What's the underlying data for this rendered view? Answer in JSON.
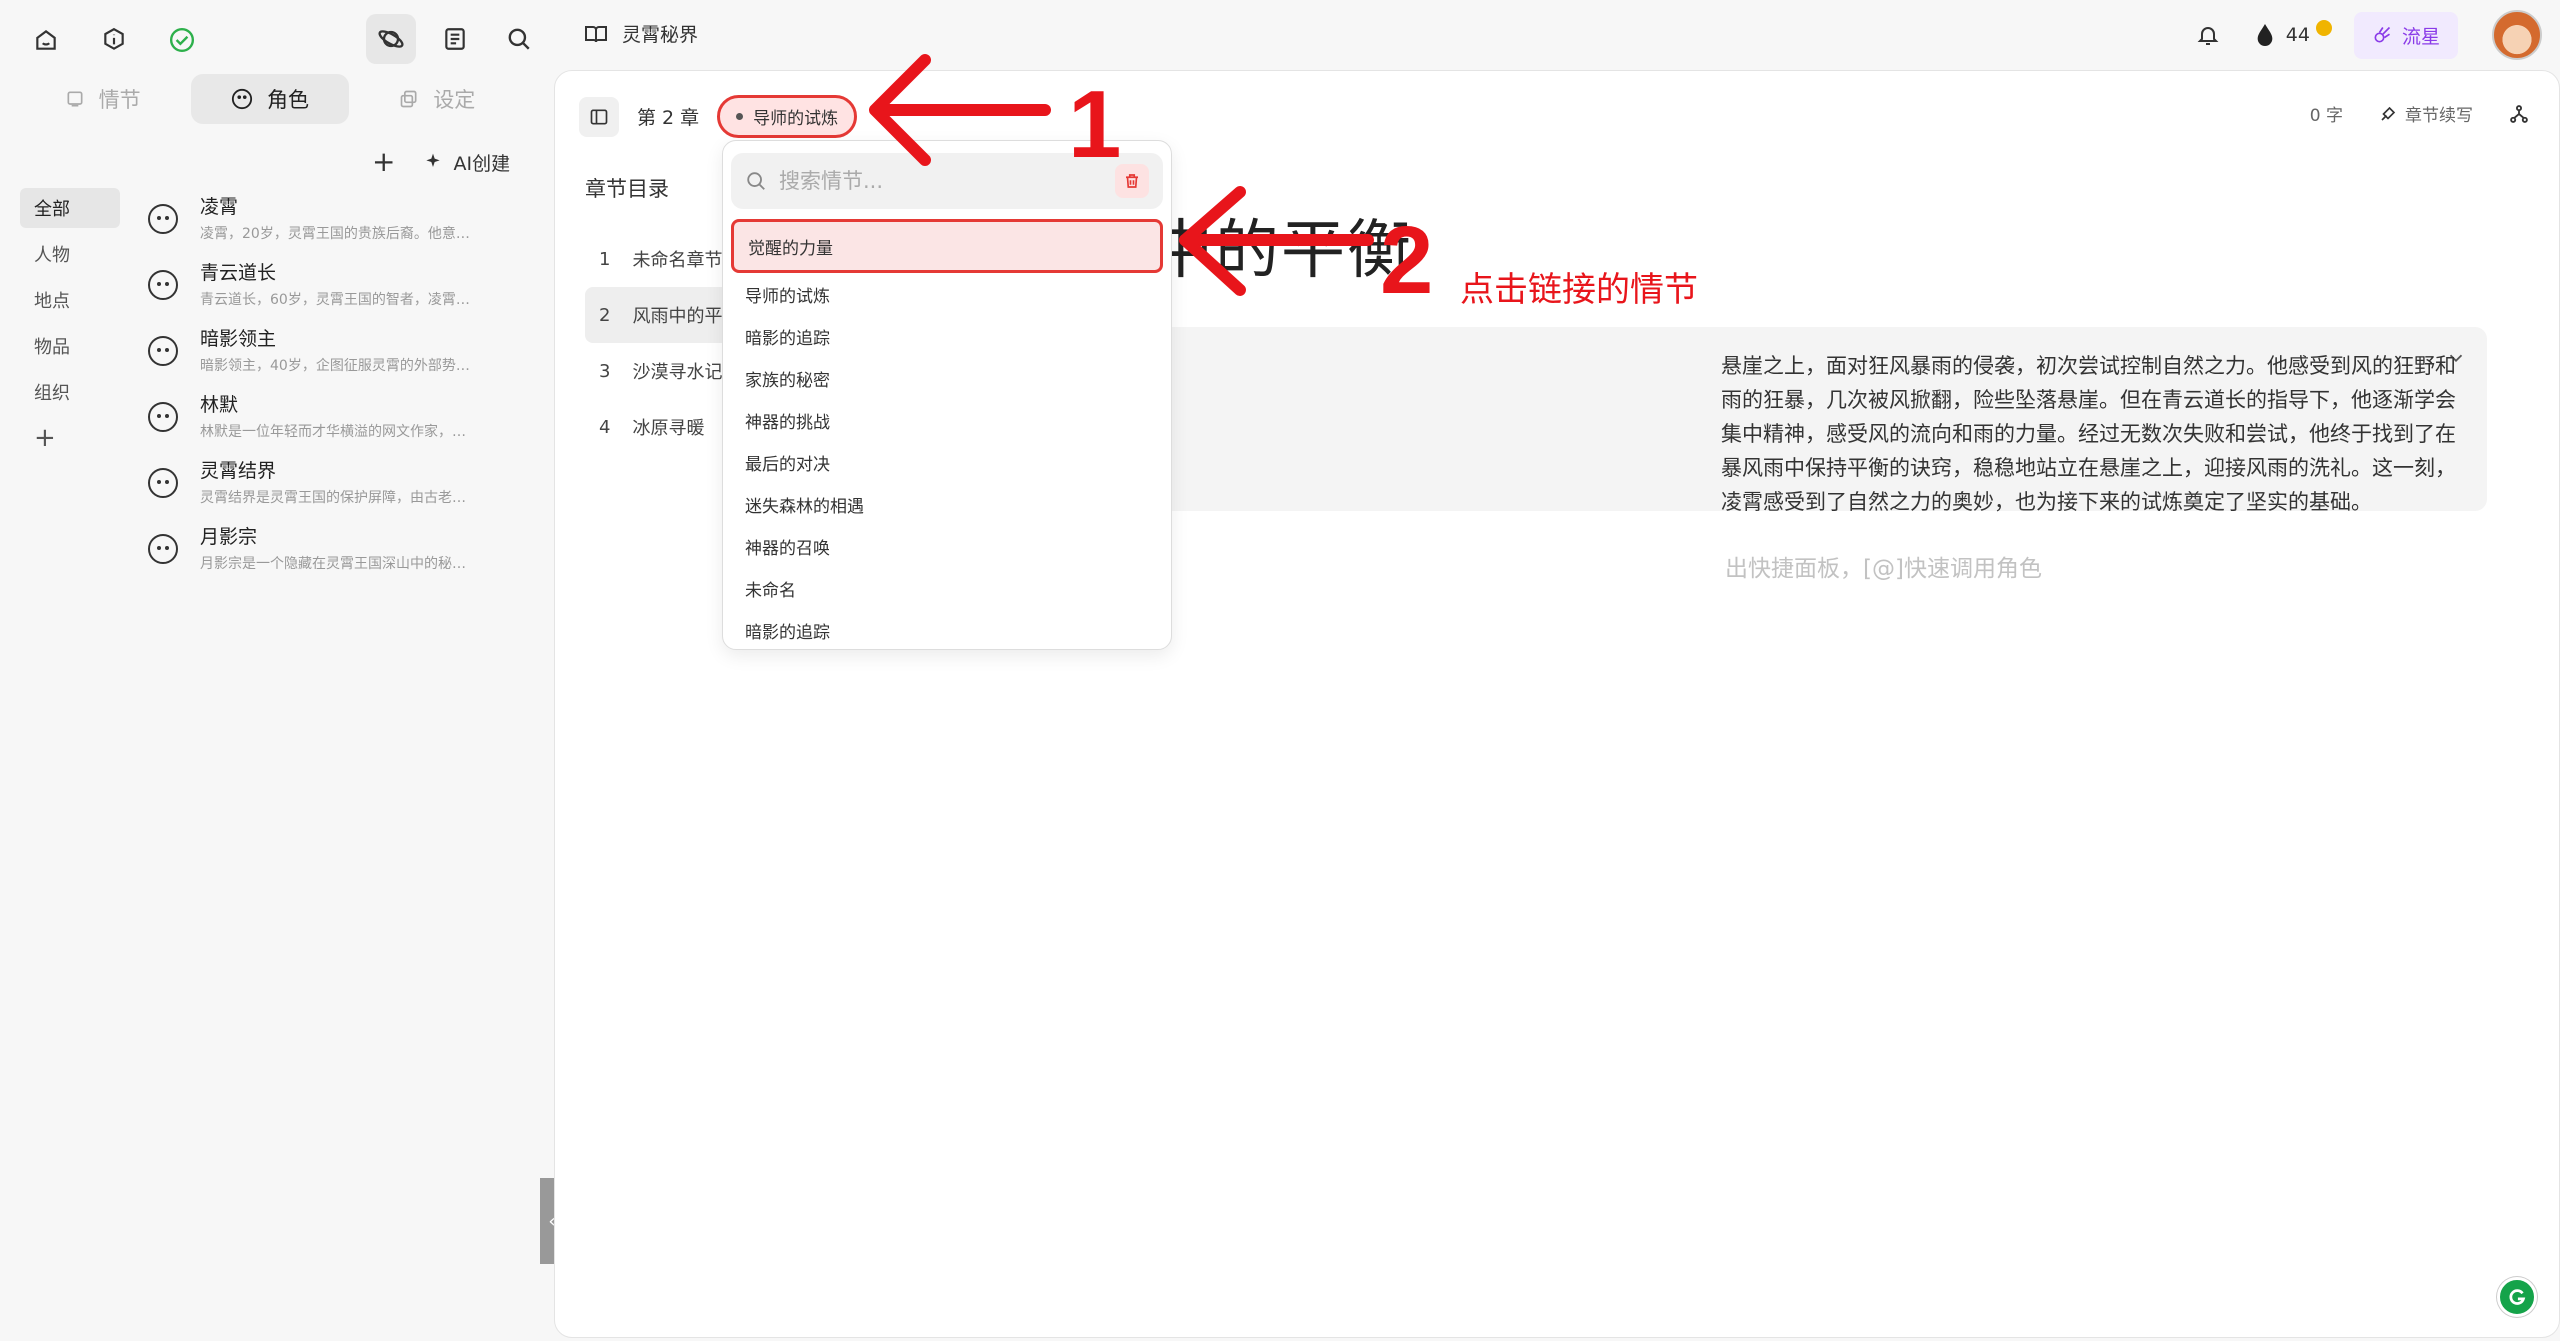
{
  "sidebar": {
    "tabs": [
      {
        "label": "情节",
        "active": false
      },
      {
        "label": "角色",
        "active": true
      },
      {
        "label": "设定",
        "active": false
      }
    ],
    "add_label": "+",
    "ai_create_label": "AI创建",
    "categories": [
      {
        "label": "全部",
        "active": true
      },
      {
        "label": "人物"
      },
      {
        "label": "地点"
      },
      {
        "label": "物品"
      },
      {
        "label": "组织"
      }
    ],
    "add_category": "+",
    "characters": [
      {
        "name": "凌霄",
        "desc": "凌霄，20岁，灵霄王国的贵族后裔。他意…"
      },
      {
        "name": "青云道长",
        "desc": "青云道长，60岁，灵霄王国的智者，凌霄…"
      },
      {
        "name": "暗影领主",
        "desc": "暗影领主，40岁，企图征服灵霄的外部势…"
      },
      {
        "name": "林默",
        "desc": "林默是一位年轻而才华横溢的网文作家，…"
      },
      {
        "name": "灵霄结界",
        "desc": "灵霄结界是灵霄王国的保护屏障，由古老…"
      },
      {
        "name": "月影宗",
        "desc": "月影宗是一个隐藏在灵霄王国深山中的秘…"
      }
    ]
  },
  "header": {
    "project": "灵霄秘界",
    "credits": "44",
    "plan": "流星"
  },
  "main": {
    "chapter_label": "第 2 章",
    "linked_plot": "导师的试炼",
    "word_count": "0 字",
    "continue_label": "章节续写",
    "toc_title": "章节目录",
    "toc": [
      {
        "num": "1",
        "title": "未命名章节"
      },
      {
        "num": "2",
        "title": "风雨中的平衡",
        "active": true
      },
      {
        "num": "3",
        "title": "沙漠寻水记"
      },
      {
        "num": "4",
        "title": "冰原寻暖"
      }
    ],
    "doc_title": "风雨中的平衡",
    "summary": "悬崖之上，面对狂风暴雨的侵袭，初次尝试控制自然之力。他感受到风的狂野和雨的狂暴，几次被风掀翻，险些坠落悬崖。但在青云道长的指导下，他逐渐学会集中精神，感受风的流向和雨的力量。经过无数次失败和尝试，他终于找到了在暴风雨中保持平衡的诀窍，稳稳地站立在悬崖之上，迎接风雨的洗礼。这一刻，凌霄感受到了自然之力的奥妙，也为接下来的试炼奠定了坚实的基础。",
    "placeholder": "出快捷面板，[@]快速调用角色"
  },
  "dropdown": {
    "search_placeholder": "搜索情节...",
    "items": [
      "觉醒的力量",
      "导师的试炼",
      "暗影的追踪",
      "家族的秘密",
      "神器的挑战",
      "最后的对决",
      "迷失森林的相遇",
      "神器的召唤",
      "未命名",
      "暗影的追踪"
    ]
  },
  "annotations": {
    "num1": "1",
    "num2": "2",
    "note": "点击链接的情节",
    "color": "#e8151b"
  }
}
